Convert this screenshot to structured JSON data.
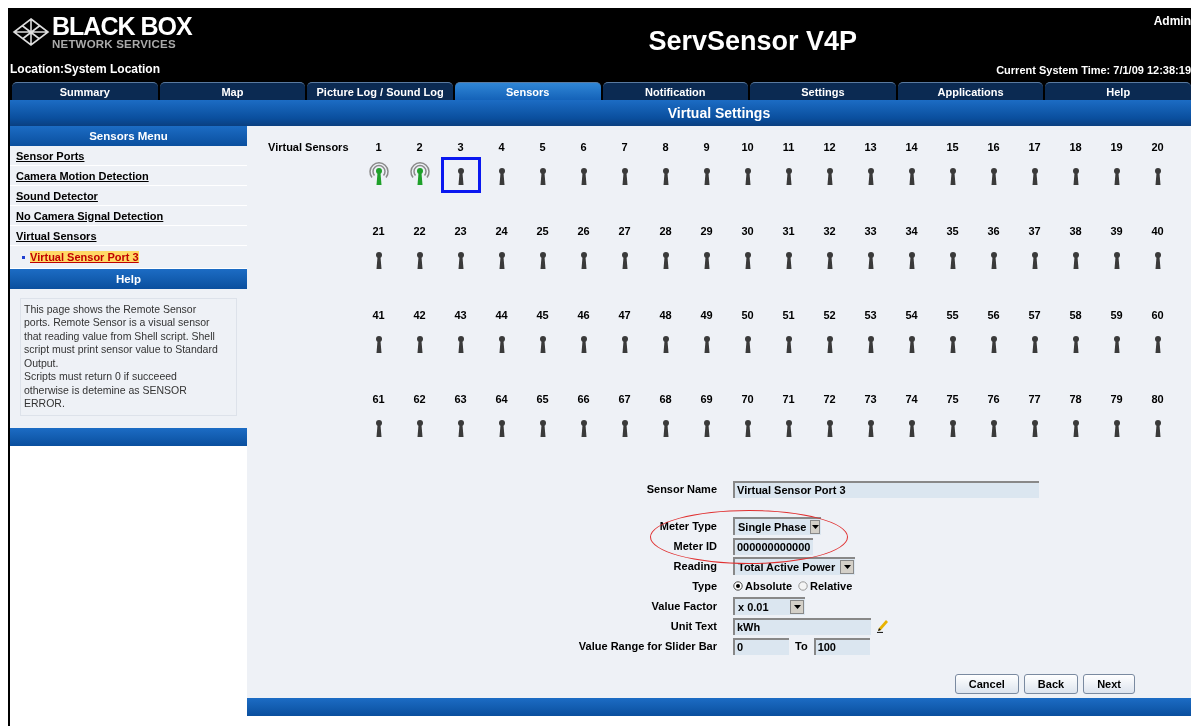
{
  "header": {
    "logo": {
      "name": "BLACK BOX",
      "tagline": "NETWORK SERVICES"
    },
    "title": "ServSensor V4P",
    "user": "Admin",
    "location": "Location:System Location",
    "time": "Current System Time: 7/1/09 12:38:19"
  },
  "tabs": [
    {
      "label": "Summary",
      "selected": false
    },
    {
      "label": "Map",
      "selected": false
    },
    {
      "label": "Picture Log / Sound Log",
      "selected": false
    },
    {
      "label": "Sensors",
      "selected": true
    },
    {
      "label": "Notification",
      "selected": false
    },
    {
      "label": "Settings",
      "selected": false
    },
    {
      "label": "Applications",
      "selected": false
    },
    {
      "label": "Help",
      "selected": false
    }
  ],
  "page_title": "Virtual Settings",
  "sidebar": {
    "menu_title": "Sensors Menu",
    "items": [
      {
        "label": "Sensor Ports",
        "selected": false
      },
      {
        "label": "Camera Motion Detection",
        "selected": false
      },
      {
        "label": "Sound Detector",
        "selected": false
      },
      {
        "label": "No Camera Signal Detection",
        "selected": false
      },
      {
        "label": "Virtual Sensors",
        "selected": false,
        "children": [
          {
            "label": "Virtual Sensor Port 3",
            "selected": true
          }
        ]
      }
    ],
    "help_title": "Help",
    "help_text": "This page shows the Remote Sensor ports. Remote Sensor is a visual sensor that reading value from Shell script. Shell script must print sensor value to Standard Output.\nScripts must return 0 if succeeed otherwise is detemine as SENSOR ERROR."
  },
  "sensor_grid": {
    "label": "Virtual Sensors",
    "sensors": [
      {
        "label": "1",
        "active": true,
        "selected": false
      },
      {
        "label": "2",
        "active": true,
        "selected": false
      },
      {
        "label": "3",
        "active": false,
        "selected": true
      },
      {
        "label": "4",
        "active": false,
        "selected": false
      },
      {
        "label": "5",
        "active": false,
        "selected": false
      },
      {
        "label": "6",
        "active": false,
        "selected": false
      },
      {
        "label": "7",
        "active": false,
        "selected": false
      },
      {
        "label": "8",
        "active": false,
        "selected": false
      },
      {
        "label": "9",
        "active": false,
        "selected": false
      },
      {
        "label": "10",
        "active": false,
        "selected": false
      },
      {
        "label": "11",
        "active": false,
        "selected": false
      },
      {
        "label": "12",
        "active": false,
        "selected": false
      },
      {
        "label": "13",
        "active": false,
        "selected": false
      },
      {
        "label": "14",
        "active": false,
        "selected": false
      },
      {
        "label": "15",
        "active": false,
        "selected": false
      },
      {
        "label": "16",
        "active": false,
        "selected": false
      },
      {
        "label": "17",
        "active": false,
        "selected": false
      },
      {
        "label": "18",
        "active": false,
        "selected": false
      },
      {
        "label": "19",
        "active": false,
        "selected": false
      },
      {
        "label": "20",
        "active": false,
        "selected": false
      },
      {
        "label": "21",
        "active": false,
        "selected": false
      },
      {
        "label": "22",
        "active": false,
        "selected": false
      },
      {
        "label": "23",
        "active": false,
        "selected": false
      },
      {
        "label": "24",
        "active": false,
        "selected": false
      },
      {
        "label": "25",
        "active": false,
        "selected": false
      },
      {
        "label": "26",
        "active": false,
        "selected": false
      },
      {
        "label": "27",
        "active": false,
        "selected": false
      },
      {
        "label": "28",
        "active": false,
        "selected": false
      },
      {
        "label": "29",
        "active": false,
        "selected": false
      },
      {
        "label": "30",
        "active": false,
        "selected": false
      },
      {
        "label": "31",
        "active": false,
        "selected": false
      },
      {
        "label": "32",
        "active": false,
        "selected": false
      },
      {
        "label": "33",
        "active": false,
        "selected": false
      },
      {
        "label": "34",
        "active": false,
        "selected": false
      },
      {
        "label": "35",
        "active": false,
        "selected": false
      },
      {
        "label": "36",
        "active": false,
        "selected": false
      },
      {
        "label": "37",
        "active": false,
        "selected": false
      },
      {
        "label": "38",
        "active": false,
        "selected": false
      },
      {
        "label": "39",
        "active": false,
        "selected": false
      },
      {
        "label": "40",
        "active": false,
        "selected": false
      },
      {
        "label": "41",
        "active": false,
        "selected": false
      },
      {
        "label": "42",
        "active": false,
        "selected": false
      },
      {
        "label": "43",
        "active": false,
        "selected": false
      },
      {
        "label": "44",
        "active": false,
        "selected": false
      },
      {
        "label": "45",
        "active": false,
        "selected": false
      },
      {
        "label": "46",
        "active": false,
        "selected": false
      },
      {
        "label": "47",
        "active": false,
        "selected": false
      },
      {
        "label": "48",
        "active": false,
        "selected": false
      },
      {
        "label": "49",
        "active": false,
        "selected": false
      },
      {
        "label": "50",
        "active": false,
        "selected": false
      },
      {
        "label": "51",
        "active": false,
        "selected": false
      },
      {
        "label": "52",
        "active": false,
        "selected": false
      },
      {
        "label": "53",
        "active": false,
        "selected": false
      },
      {
        "label": "54",
        "active": false,
        "selected": false
      },
      {
        "label": "55",
        "active": false,
        "selected": false
      },
      {
        "label": "56",
        "active": false,
        "selected": false
      },
      {
        "label": "57",
        "active": false,
        "selected": false
      },
      {
        "label": "58",
        "active": false,
        "selected": false
      },
      {
        "label": "59",
        "active": false,
        "selected": false
      },
      {
        "label": "60",
        "active": false,
        "selected": false
      },
      {
        "label": "61",
        "active": false,
        "selected": false
      },
      {
        "label": "62",
        "active": false,
        "selected": false
      },
      {
        "label": "63",
        "active": false,
        "selected": false
      },
      {
        "label": "64",
        "active": false,
        "selected": false
      },
      {
        "label": "65",
        "active": false,
        "selected": false
      },
      {
        "label": "66",
        "active": false,
        "selected": false
      },
      {
        "label": "67",
        "active": false,
        "selected": false
      },
      {
        "label": "68",
        "active": false,
        "selected": false
      },
      {
        "label": "69",
        "active": false,
        "selected": false
      },
      {
        "label": "70",
        "active": false,
        "selected": false
      },
      {
        "label": "71",
        "active": false,
        "selected": false
      },
      {
        "label": "72",
        "active": false,
        "selected": false
      },
      {
        "label": "73",
        "active": false,
        "selected": false
      },
      {
        "label": "74",
        "active": false,
        "selected": false
      },
      {
        "label": "75",
        "active": false,
        "selected": false
      },
      {
        "label": "76",
        "active": false,
        "selected": false
      },
      {
        "label": "77",
        "active": false,
        "selected": false
      },
      {
        "label": "78",
        "active": false,
        "selected": false
      },
      {
        "label": "79",
        "active": false,
        "selected": false
      },
      {
        "label": "80",
        "active": false,
        "selected": false
      }
    ]
  },
  "form": {
    "fields": [
      {
        "kind": "text",
        "label": "Sensor Name",
        "value": "Virtual Sensor Port 3",
        "circled": false
      },
      {
        "kind": "select",
        "label": "Meter Type",
        "value": "Single Phase",
        "circled": true
      },
      {
        "kind": "text",
        "label": "Meter ID",
        "value": "000000000000",
        "circled": true
      },
      {
        "kind": "select",
        "label": "Reading",
        "value": "Total Active Power",
        "circled": false
      },
      {
        "kind": "radio",
        "label": "Type",
        "options": [
          {
            "label": "Absolute",
            "selected": true
          },
          {
            "label": "Relative",
            "selected": false
          }
        ],
        "circled": false
      },
      {
        "kind": "select",
        "label": "Value Factor",
        "value": "x 0.01",
        "circled": false
      },
      {
        "kind": "pencil",
        "label": "Unit Text",
        "value": "kWh",
        "circled": false
      },
      {
        "kind": "range",
        "label": "Value Range for Slider Bar",
        "value": "0",
        "to_label": "To",
        "to_value": "100",
        "circled": false
      }
    ],
    "buttons": [
      "Cancel",
      "Back",
      "Next"
    ]
  }
}
